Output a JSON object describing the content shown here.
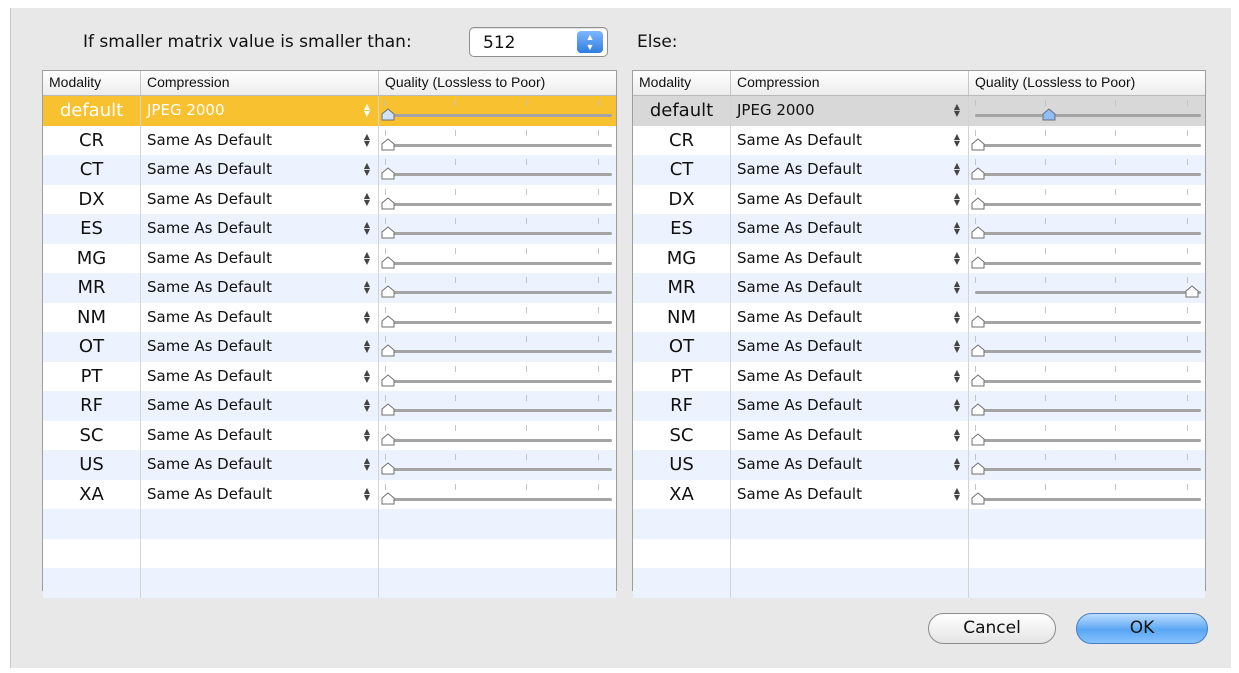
{
  "header": {
    "condition_label": "If smaller matrix value is smaller than:",
    "threshold_value": "512",
    "else_label": "Else:"
  },
  "columns": {
    "modality": "Modality",
    "compression": "Compression",
    "quality": "Quality (Lossless to Poor)"
  },
  "left_table": {
    "rows": [
      {
        "modality": "default",
        "compression": "JPEG 2000",
        "quality": 0
      },
      {
        "modality": "CR",
        "compression": "Same As Default",
        "quality": 0
      },
      {
        "modality": "CT",
        "compression": "Same As Default",
        "quality": 0
      },
      {
        "modality": "DX",
        "compression": "Same As Default",
        "quality": 0
      },
      {
        "modality": "ES",
        "compression": "Same As Default",
        "quality": 0
      },
      {
        "modality": "MG",
        "compression": "Same As Default",
        "quality": 0
      },
      {
        "modality": "MR",
        "compression": "Same As Default",
        "quality": 0
      },
      {
        "modality": "NM",
        "compression": "Same As Default",
        "quality": 0
      },
      {
        "modality": "OT",
        "compression": "Same As Default",
        "quality": 0
      },
      {
        "modality": "PT",
        "compression": "Same As Default",
        "quality": 0
      },
      {
        "modality": "RF",
        "compression": "Same As Default",
        "quality": 0
      },
      {
        "modality": "SC",
        "compression": "Same As Default",
        "quality": 0
      },
      {
        "modality": "US",
        "compression": "Same As Default",
        "quality": 0
      },
      {
        "modality": "XA",
        "compression": "Same As Default",
        "quality": 0
      }
    ]
  },
  "right_table": {
    "rows": [
      {
        "modality": "default",
        "compression": "JPEG 2000",
        "quality": 0.33
      },
      {
        "modality": "CR",
        "compression": "Same As Default",
        "quality": 0
      },
      {
        "modality": "CT",
        "compression": "Same As Default",
        "quality": 0
      },
      {
        "modality": "DX",
        "compression": "Same As Default",
        "quality": 0
      },
      {
        "modality": "ES",
        "compression": "Same As Default",
        "quality": 0
      },
      {
        "modality": "MG",
        "compression": "Same As Default",
        "quality": 0
      },
      {
        "modality": "MR",
        "compression": "Same As Default",
        "quality": 1
      },
      {
        "modality": "NM",
        "compression": "Same As Default",
        "quality": 0
      },
      {
        "modality": "OT",
        "compression": "Same As Default",
        "quality": 0
      },
      {
        "modality": "PT",
        "compression": "Same As Default",
        "quality": 0
      },
      {
        "modality": "RF",
        "compression": "Same As Default",
        "quality": 0
      },
      {
        "modality": "SC",
        "compression": "Same As Default",
        "quality": 0
      },
      {
        "modality": "US",
        "compression": "Same As Default",
        "quality": 0
      },
      {
        "modality": "XA",
        "compression": "Same As Default",
        "quality": 0
      }
    ]
  },
  "buttons": {
    "cancel": "Cancel",
    "ok": "OK"
  },
  "colors": {
    "selected_row": "#f8c130",
    "alt_row": "#edf3fe",
    "ok_button": "#5aa6f3"
  }
}
